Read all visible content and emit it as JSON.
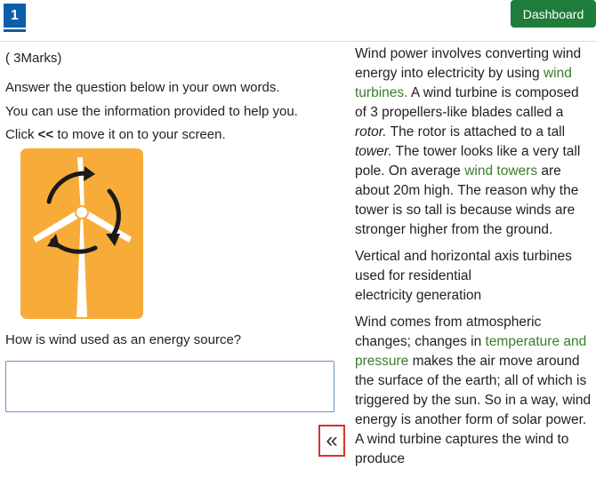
{
  "header": {
    "question_number": "1",
    "dashboard_label": "Dashboard"
  },
  "question": {
    "marks": "( 3Marks)",
    "instruction1": "Answer the question below in your own words.",
    "instruction2": "You can use the information provided to help you.",
    "click_prefix": "Click ",
    "click_symbol": "<<",
    "click_suffix": " to move it on to your screen.",
    "prompt": "How is wind used as an energy source?",
    "answer_value": "",
    "move_symbol": "«"
  },
  "image": {
    "icon": "wind-turbine-icon",
    "background_color": "#f7ac3a"
  },
  "passage": {
    "p1": [
      {
        "t": "Wind power involves converting wind energy into electricity by using ",
        "s": "plain"
      },
      {
        "t": "wind turbines.",
        "s": "green"
      },
      {
        "t": " A wind turbine is composed of 3 propellers-like blades called a ",
        "s": "plain"
      },
      {
        "t": "rotor.",
        "s": "em"
      },
      {
        "t": " The rotor is attached to a tall ",
        "s": "plain"
      },
      {
        "t": "tower.",
        "s": "em"
      },
      {
        "t": " The tower looks like a very tall pole. On average ",
        "s": "plain"
      },
      {
        "t": "wind towers",
        "s": "green"
      },
      {
        "t": " are about 20m high. The reason why the tower is so tall is because winds are stronger higher from the ground.",
        "s": "plain"
      }
    ],
    "p2_line1": "Vertical and horizontal axis  turbines",
    "p2_line2": "used for residential",
    "p2_line3": "electricity generation",
    "p3": [
      {
        "t": "Wind comes from atmospheric changes; changes in ",
        "s": "plain"
      },
      {
        "t": "temperature and pressure",
        "s": "green"
      },
      {
        "t": " makes the air move around the surface of the earth; all of which is triggered by the sun. So in a way, wind energy is another form of solar power. A wind turbine captures the wind to produce",
        "s": "plain"
      }
    ]
  },
  "colors": {
    "tab_blue": "#0b5ea8",
    "dashboard_green": "#1e7d3a",
    "link_green": "#3a7d2a",
    "highlight_red": "#d9302a"
  }
}
